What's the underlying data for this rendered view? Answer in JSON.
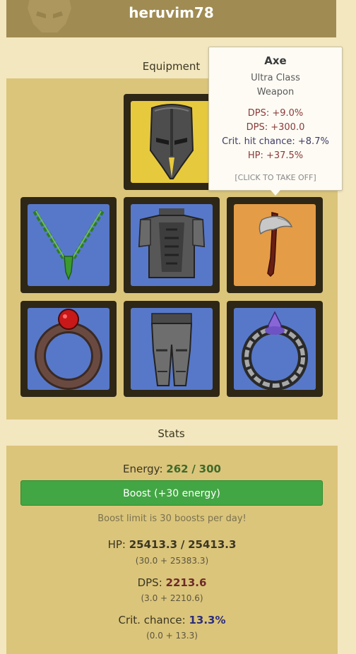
{
  "header": {
    "username": "heruvim78"
  },
  "equipment": {
    "title": "Equipment",
    "slots": [
      {
        "id": "helmet",
        "icon": "helmet-icon",
        "bg": "#e7c93e"
      },
      {
        "id": "necklace",
        "icon": "necklace-icon",
        "bg": "#5778c9"
      },
      {
        "id": "armor",
        "icon": "armor-icon",
        "bg": "#5778c9"
      },
      {
        "id": "weapon",
        "icon": "axe-icon",
        "bg": "#e59c46"
      },
      {
        "id": "ring-left",
        "icon": "ring-ruby-icon",
        "bg": "#5778c9"
      },
      {
        "id": "pants",
        "icon": "pants-icon",
        "bg": "#5778c9"
      },
      {
        "id": "ring-right",
        "icon": "ring-amethyst-icon",
        "bg": "#5778c9"
      }
    ]
  },
  "tooltip": {
    "name": "Axe",
    "class_line1": "Ultra Class",
    "class_line2": "Weapon",
    "stats": [
      "DPS: +9.0%",
      "DPS: +300.0",
      "Crit. hit chance: +8.7%",
      "HP: +37.5%"
    ],
    "action": "[CLICK TO TAKE OFF]"
  },
  "stats": {
    "title": "Stats",
    "energy_label": "Energy:",
    "energy_current": "262",
    "energy_sep": "/",
    "energy_max": "300",
    "boost_label": "Boost (+30 energy)",
    "boost_limit": "Boost limit is 30 boosts per day!",
    "hp_label": "HP:",
    "hp_current": "25413.3",
    "hp_sep": "/",
    "hp_max": "25413.3",
    "hp_breakdown": "(30.0 + 25383.3)",
    "dps_label": "DPS:",
    "dps_value": "2213.6",
    "dps_breakdown": "(3.0 + 2210.6)",
    "crit_label": "Crit. chance:",
    "crit_value": "13.3%",
    "crit_breakdown": "(0.0 + 13.3)"
  }
}
